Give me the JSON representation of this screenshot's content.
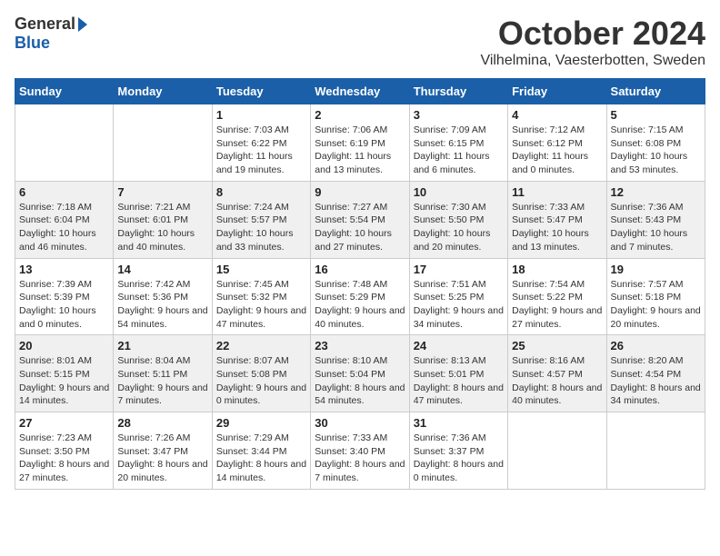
{
  "header": {
    "logo_general": "General",
    "logo_blue": "Blue",
    "title": "October 2024",
    "location": "Vilhelmina, Vaesterbotten, Sweden"
  },
  "weekdays": [
    "Sunday",
    "Monday",
    "Tuesday",
    "Wednesday",
    "Thursday",
    "Friday",
    "Saturday"
  ],
  "weeks": [
    [
      {
        "day": "",
        "sunrise": "",
        "sunset": "",
        "daylight": ""
      },
      {
        "day": "",
        "sunrise": "",
        "sunset": "",
        "daylight": ""
      },
      {
        "day": "1",
        "sunrise": "Sunrise: 7:03 AM",
        "sunset": "Sunset: 6:22 PM",
        "daylight": "Daylight: 11 hours and 19 minutes."
      },
      {
        "day": "2",
        "sunrise": "Sunrise: 7:06 AM",
        "sunset": "Sunset: 6:19 PM",
        "daylight": "Daylight: 11 hours and 13 minutes."
      },
      {
        "day": "3",
        "sunrise": "Sunrise: 7:09 AM",
        "sunset": "Sunset: 6:15 PM",
        "daylight": "Daylight: 11 hours and 6 minutes."
      },
      {
        "day": "4",
        "sunrise": "Sunrise: 7:12 AM",
        "sunset": "Sunset: 6:12 PM",
        "daylight": "Daylight: 11 hours and 0 minutes."
      },
      {
        "day": "5",
        "sunrise": "Sunrise: 7:15 AM",
        "sunset": "Sunset: 6:08 PM",
        "daylight": "Daylight: 10 hours and 53 minutes."
      }
    ],
    [
      {
        "day": "6",
        "sunrise": "Sunrise: 7:18 AM",
        "sunset": "Sunset: 6:04 PM",
        "daylight": "Daylight: 10 hours and 46 minutes."
      },
      {
        "day": "7",
        "sunrise": "Sunrise: 7:21 AM",
        "sunset": "Sunset: 6:01 PM",
        "daylight": "Daylight: 10 hours and 40 minutes."
      },
      {
        "day": "8",
        "sunrise": "Sunrise: 7:24 AM",
        "sunset": "Sunset: 5:57 PM",
        "daylight": "Daylight: 10 hours and 33 minutes."
      },
      {
        "day": "9",
        "sunrise": "Sunrise: 7:27 AM",
        "sunset": "Sunset: 5:54 PM",
        "daylight": "Daylight: 10 hours and 27 minutes."
      },
      {
        "day": "10",
        "sunrise": "Sunrise: 7:30 AM",
        "sunset": "Sunset: 5:50 PM",
        "daylight": "Daylight: 10 hours and 20 minutes."
      },
      {
        "day": "11",
        "sunrise": "Sunrise: 7:33 AM",
        "sunset": "Sunset: 5:47 PM",
        "daylight": "Daylight: 10 hours and 13 minutes."
      },
      {
        "day": "12",
        "sunrise": "Sunrise: 7:36 AM",
        "sunset": "Sunset: 5:43 PM",
        "daylight": "Daylight: 10 hours and 7 minutes."
      }
    ],
    [
      {
        "day": "13",
        "sunrise": "Sunrise: 7:39 AM",
        "sunset": "Sunset: 5:39 PM",
        "daylight": "Daylight: 10 hours and 0 minutes."
      },
      {
        "day": "14",
        "sunrise": "Sunrise: 7:42 AM",
        "sunset": "Sunset: 5:36 PM",
        "daylight": "Daylight: 9 hours and 54 minutes."
      },
      {
        "day": "15",
        "sunrise": "Sunrise: 7:45 AM",
        "sunset": "Sunset: 5:32 PM",
        "daylight": "Daylight: 9 hours and 47 minutes."
      },
      {
        "day": "16",
        "sunrise": "Sunrise: 7:48 AM",
        "sunset": "Sunset: 5:29 PM",
        "daylight": "Daylight: 9 hours and 40 minutes."
      },
      {
        "day": "17",
        "sunrise": "Sunrise: 7:51 AM",
        "sunset": "Sunset: 5:25 PM",
        "daylight": "Daylight: 9 hours and 34 minutes."
      },
      {
        "day": "18",
        "sunrise": "Sunrise: 7:54 AM",
        "sunset": "Sunset: 5:22 PM",
        "daylight": "Daylight: 9 hours and 27 minutes."
      },
      {
        "day": "19",
        "sunrise": "Sunrise: 7:57 AM",
        "sunset": "Sunset: 5:18 PM",
        "daylight": "Daylight: 9 hours and 20 minutes."
      }
    ],
    [
      {
        "day": "20",
        "sunrise": "Sunrise: 8:01 AM",
        "sunset": "Sunset: 5:15 PM",
        "daylight": "Daylight: 9 hours and 14 minutes."
      },
      {
        "day": "21",
        "sunrise": "Sunrise: 8:04 AM",
        "sunset": "Sunset: 5:11 PM",
        "daylight": "Daylight: 9 hours and 7 minutes."
      },
      {
        "day": "22",
        "sunrise": "Sunrise: 8:07 AM",
        "sunset": "Sunset: 5:08 PM",
        "daylight": "Daylight: 9 hours and 0 minutes."
      },
      {
        "day": "23",
        "sunrise": "Sunrise: 8:10 AM",
        "sunset": "Sunset: 5:04 PM",
        "daylight": "Daylight: 8 hours and 54 minutes."
      },
      {
        "day": "24",
        "sunrise": "Sunrise: 8:13 AM",
        "sunset": "Sunset: 5:01 PM",
        "daylight": "Daylight: 8 hours and 47 minutes."
      },
      {
        "day": "25",
        "sunrise": "Sunrise: 8:16 AM",
        "sunset": "Sunset: 4:57 PM",
        "daylight": "Daylight: 8 hours and 40 minutes."
      },
      {
        "day": "26",
        "sunrise": "Sunrise: 8:20 AM",
        "sunset": "Sunset: 4:54 PM",
        "daylight": "Daylight: 8 hours and 34 minutes."
      }
    ],
    [
      {
        "day": "27",
        "sunrise": "Sunrise: 7:23 AM",
        "sunset": "Sunset: 3:50 PM",
        "daylight": "Daylight: 8 hours and 27 minutes."
      },
      {
        "day": "28",
        "sunrise": "Sunrise: 7:26 AM",
        "sunset": "Sunset: 3:47 PM",
        "daylight": "Daylight: 8 hours and 20 minutes."
      },
      {
        "day": "29",
        "sunrise": "Sunrise: 7:29 AM",
        "sunset": "Sunset: 3:44 PM",
        "daylight": "Daylight: 8 hours and 14 minutes."
      },
      {
        "day": "30",
        "sunrise": "Sunrise: 7:33 AM",
        "sunset": "Sunset: 3:40 PM",
        "daylight": "Daylight: 8 hours and 7 minutes."
      },
      {
        "day": "31",
        "sunrise": "Sunrise: 7:36 AM",
        "sunset": "Sunset: 3:37 PM",
        "daylight": "Daylight: 8 hours and 0 minutes."
      },
      {
        "day": "",
        "sunrise": "",
        "sunset": "",
        "daylight": ""
      },
      {
        "day": "",
        "sunrise": "",
        "sunset": "",
        "daylight": ""
      }
    ]
  ]
}
